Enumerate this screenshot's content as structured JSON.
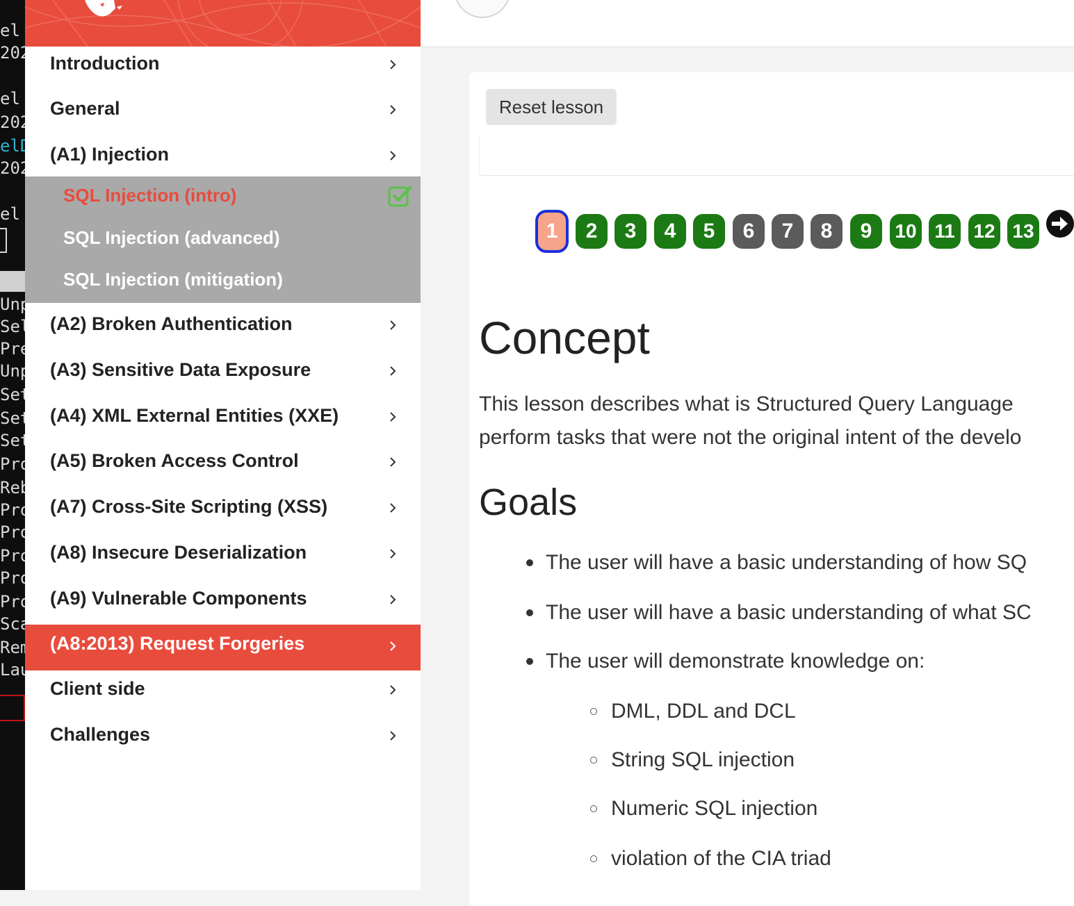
{
  "terminal": {
    "lines": [
      "el",
      "202",
      "",
      "el",
      "202",
      "elD",
      "202",
      "",
      "el",
      "",
      "",
      "Unp",
      "Sel",
      "Pre",
      "Unp",
      "Set",
      "Set",
      "Set",
      "Pro",
      "Reb",
      "Pro",
      "Pro",
      "Pro",
      "Pro",
      "Pro",
      "Sca",
      "Rem",
      "Lau"
    ]
  },
  "sidebar": {
    "items": [
      {
        "label": "Introduction"
      },
      {
        "label": "General"
      },
      {
        "label": "(A1) Injection"
      },
      {
        "label": "(A2) Broken Authentication"
      },
      {
        "label": "(A3) Sensitive Data Exposure"
      },
      {
        "label": "(A4) XML External Entities (XXE)"
      },
      {
        "label": "(A5) Broken Access Control"
      },
      {
        "label": "(A7) Cross-Site Scripting (XSS)"
      },
      {
        "label": "(A8) Insecure Deserialization"
      },
      {
        "label": "(A9) Vulnerable Components"
      },
      {
        "label": "(A8:2013) Request Forgeries"
      },
      {
        "label": "Client side"
      },
      {
        "label": "Challenges"
      }
    ],
    "submenu": [
      {
        "label": "SQL Injection (intro)"
      },
      {
        "label": "SQL Injection (advanced)"
      },
      {
        "label": "SQL Injection (mitigation)"
      }
    ]
  },
  "lesson": {
    "reset_label": "Reset lesson",
    "pages": [
      {
        "n": "1",
        "state": "current"
      },
      {
        "n": "2",
        "state": "done"
      },
      {
        "n": "3",
        "state": "done"
      },
      {
        "n": "4",
        "state": "done"
      },
      {
        "n": "5",
        "state": "done"
      },
      {
        "n": "6",
        "state": "todo"
      },
      {
        "n": "7",
        "state": "todo"
      },
      {
        "n": "8",
        "state": "todo"
      },
      {
        "n": "9",
        "state": "done"
      },
      {
        "n": "10",
        "state": "done"
      },
      {
        "n": "11",
        "state": "done"
      },
      {
        "n": "12",
        "state": "done"
      },
      {
        "n": "13",
        "state": "done"
      }
    ],
    "concept_heading": "Concept",
    "concept_line1": "This lesson describes what is Structured Query Language",
    "concept_line2": "perform tasks that were not the original intent of the develo",
    "goals_heading": "Goals",
    "goals": [
      "The user will have a basic understanding of how SQ",
      "The user will have a basic understanding of what SC",
      "The user will demonstrate knowledge on:"
    ],
    "sub_goals": [
      "DML, DDL and DCL",
      "String SQL injection",
      "Numeric SQL injection",
      "violation of the CIA triad"
    ]
  },
  "colors": {
    "brand": "#e84c3d",
    "done": "#1c7a14",
    "todo": "#5b5b5b",
    "current": "#f7a58a"
  },
  "icons": [
    "chevron-right-icon",
    "check-square-icon",
    "arrow-circle-right-icon",
    "webgoat-logo"
  ]
}
